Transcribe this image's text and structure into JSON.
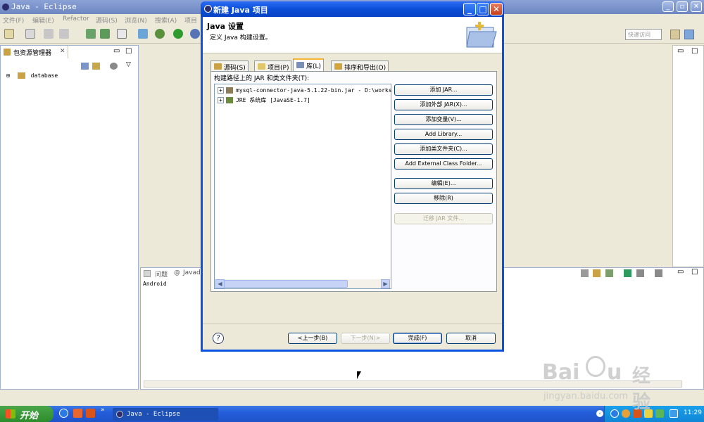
{
  "eclipse": {
    "title": "Java - Eclipse",
    "menu": [
      "文件(F)",
      "编辑(E)",
      "Refactor",
      "源码(S)",
      "浏览(N)",
      "搜索(A)",
      "项目"
    ],
    "quick_access_placeholder": "快速访问",
    "package_view_title": "包资源管理器",
    "project_item": "database",
    "bottom_tabs": [
      "问题",
      "Javad"
    ],
    "bottom_content": "Android"
  },
  "dialog": {
    "title": "新建 Java 项目",
    "heading": "Java 设置",
    "description": "定义 Java 构建设置。",
    "tabs": [
      {
        "label": "源码(S)",
        "icon": "source-folder-icon"
      },
      {
        "label": "项目(P)",
        "icon": "project-folder-icon"
      },
      {
        "label": "库(L)",
        "icon": "library-icon",
        "active": true
      },
      {
        "label": "排序和导出(O)",
        "icon": "order-export-icon"
      }
    ],
    "build_path_label": "构建路径上的 JAR 和类文件夹(T):",
    "tree_items": [
      {
        "label": "mysql-connector-java-5.1.22-bin.jar - D:\\works",
        "icon": "jar-icon"
      },
      {
        "label": "JRE 系统库 [JavaSE-1.7]",
        "icon": "jre-library-icon"
      }
    ],
    "buttons": {
      "add_jar": "添加 JAR...",
      "add_external_jar": "添加外部 JAR(X)...",
      "add_variable": "添加变量(V)...",
      "add_library": "Add Library...",
      "add_class_folder": "添加类文件夹(C)...",
      "add_external_class_folder": "Add External Class Folder...",
      "edit": "编辑(E)...",
      "remove": "移除(R)",
      "migrate_jar": "迁移 JAR 文件..."
    },
    "footer": {
      "back": "<上一步(B)",
      "next": "下一步(N)>",
      "finish": "完成(F)",
      "cancel": "取消"
    }
  },
  "taskbar": {
    "start": "开始",
    "task": "Java - Eclipse",
    "clock": "11:29"
  },
  "watermark": {
    "brand": "Bai",
    "brand_cn": "经验",
    "url": "jingyan.baidu.com"
  },
  "colors": {
    "xp_blue": "#0a4fd8",
    "selection": "#316ac5",
    "tab_highlight": "#f7b534"
  }
}
